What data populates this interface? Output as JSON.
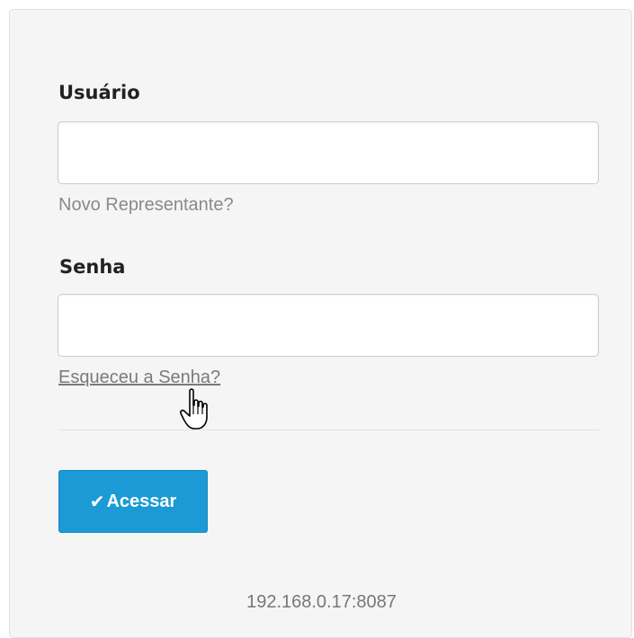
{
  "form": {
    "username_label": "Usuário",
    "username_value": "",
    "username_help": "Novo Representante?",
    "password_label": "Senha",
    "password_value": "",
    "forgot_link": "Esqueceu a Senha?",
    "submit_label": "Acessar",
    "submit_icon": "check-icon"
  },
  "footer": {
    "address": "192.168.0.17:8087"
  },
  "colors": {
    "panel_bg": "#f5f5f5",
    "button_bg": "#1b9ad6",
    "help_text": "#8a8a8a"
  }
}
